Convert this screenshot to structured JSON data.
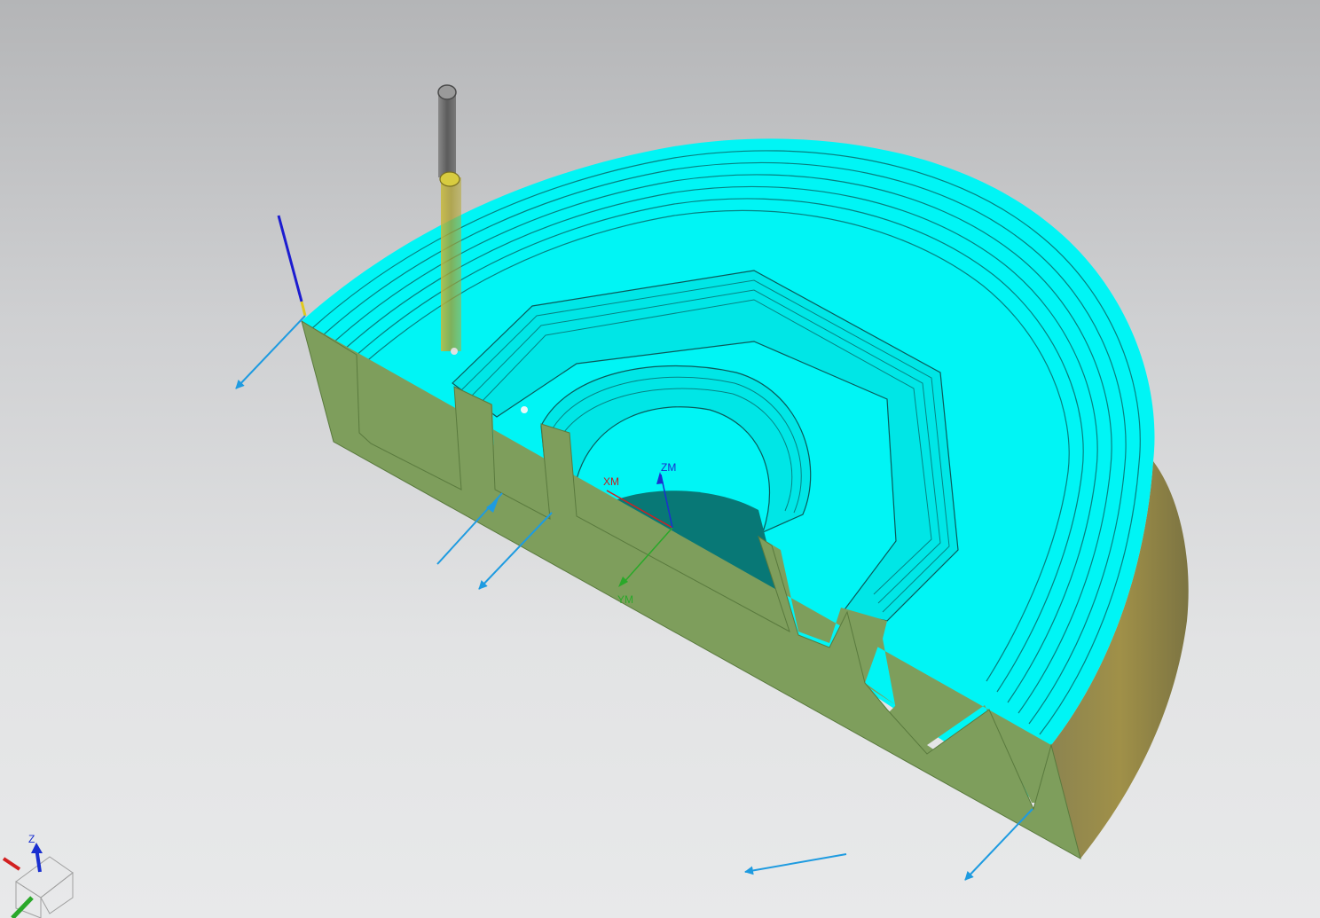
{
  "viewport": {
    "background_top": "#b4b5b7",
    "background_bottom": "#e8e9ea"
  },
  "csys": {
    "x_label": "XM",
    "y_label": "YM",
    "z_label": "ZM",
    "x_color": "#d22020",
    "y_color": "#2aa82a",
    "z_color": "#1a2fd0"
  },
  "triad": {
    "z_label": "Z"
  },
  "part": {
    "machined_color": "#00ffff",
    "section_color": "#7e9e5c",
    "outer_wall_color": "#948a4a",
    "floor_color": "#087876"
  },
  "tool": {
    "shank_color": "#6c6c6c",
    "cutter_color": "#c8b830"
  },
  "vectors": {
    "color": "#1e9be0",
    "count": 7
  }
}
